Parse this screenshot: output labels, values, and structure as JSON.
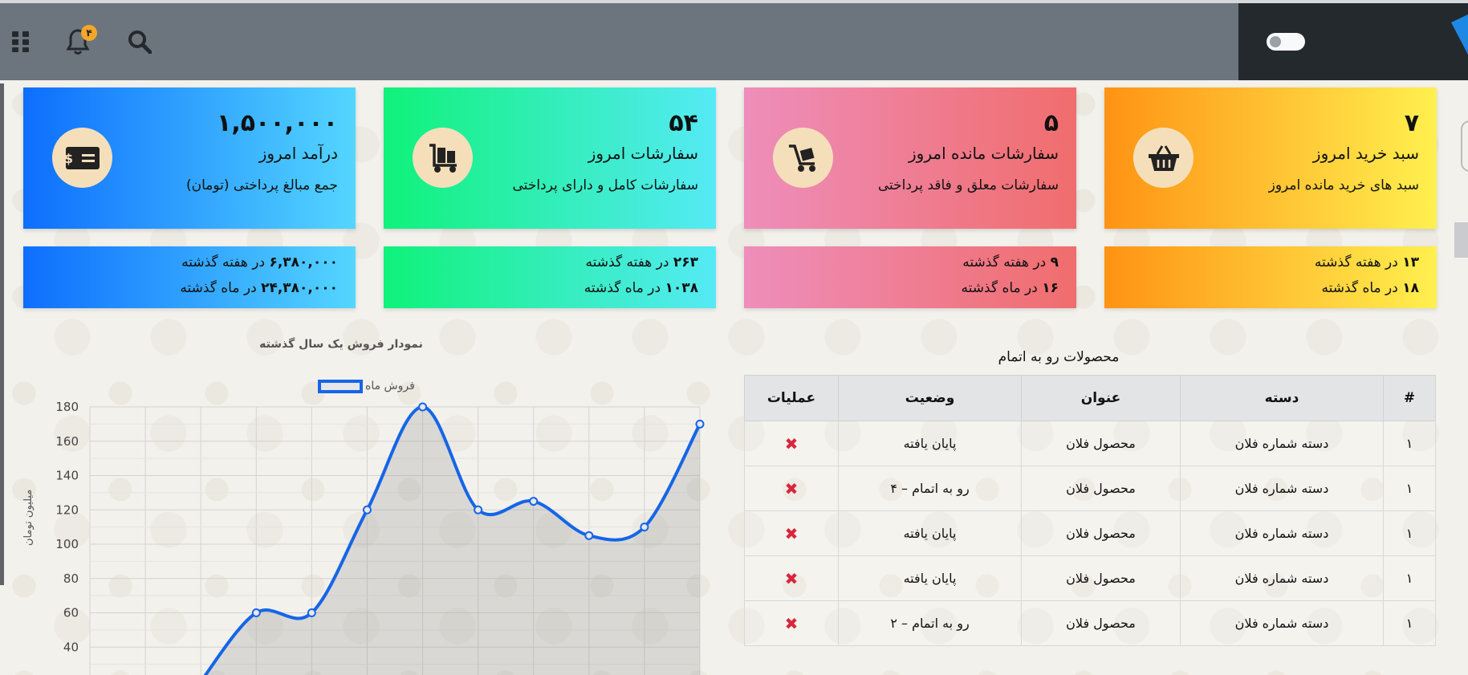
{
  "header": {
    "notification_count": "۴",
    "icons": [
      "apps-grid-icon",
      "bell-icon",
      "search-icon"
    ]
  },
  "cards": [
    {
      "number": "۷",
      "title": "سبد خرید امروز",
      "desc": "سبد های خرید مانده امروز",
      "icon": "basket-icon",
      "color": "#ff9314"
    },
    {
      "number": "۵",
      "title": "سفارشات مانده امروز",
      "desc": "سفارشات معلق و فاقد پرداختی",
      "icon": "cart-icon",
      "color": "#f06d6d"
    },
    {
      "number": "۵۴",
      "title": "سفارشات امروز",
      "desc": "سفارشات کامل و دارای پرداختی",
      "icon": "trolley-icon",
      "color": "#0ff27a"
    },
    {
      "number": "۱,۵۰۰,۰۰۰",
      "title": "درآمد امروز",
      "desc": "جمع مبالغ پرداختی (تومان)",
      "icon": "money-icon",
      "color": "#0d6efd"
    }
  ],
  "subcards": [
    {
      "v1": "۱۳",
      "t1": "در هفته گذشته",
      "v2": "۱۸",
      "t2": "در ماه گذشته"
    },
    {
      "v1": "۹",
      "t1": "در هفته گذشته",
      "v2": "۱۶",
      "t2": "در ماه گذشته"
    },
    {
      "v1": "۲۶۳",
      "t1": "در هفته گذشته",
      "v2": "۱۰۳۸",
      "t2": "در ماه گذشته"
    },
    {
      "v1": "۶,۳۸۰,۰۰۰",
      "t1": "در هفته گذشته",
      "v2": "۲۴,۳۸۰,۰۰۰",
      "t2": "در ماه گذشته"
    }
  ],
  "chart_data": {
    "type": "area",
    "title": "نمودار فروش یک سال گذشته",
    "ylabel": "میلیون تومان",
    "series": [
      {
        "name": "فروش ماه",
        "values": [
          null,
          null,
          20,
          60,
          60,
          120,
          180,
          120,
          125,
          105,
          110,
          170
        ]
      }
    ],
    "ylim": [
      20,
      180
    ],
    "yticks": [
      40,
      60,
      80,
      100,
      120,
      140,
      160,
      180
    ],
    "grid": true,
    "line_color": "#1565e8"
  },
  "table": {
    "title": "محصولات رو به اتمام",
    "headers": [
      "#",
      "دسته",
      "عنوان",
      "وضعیت",
      "عملیات"
    ],
    "rows": [
      {
        "num": "۱",
        "category": "دسته شماره فلان",
        "name": "محصول فلان",
        "status": "پایان یافته",
        "action": "✖"
      },
      {
        "num": "۱",
        "category": "دسته شماره فلان",
        "name": "محصول فلان",
        "status": "رو به اتمام – ۴",
        "action": "✖"
      },
      {
        "num": "۱",
        "category": "دسته شماره فلان",
        "name": "محصول فلان",
        "status": "پایان یافته",
        "action": "✖"
      },
      {
        "num": "۱",
        "category": "دسته شماره فلان",
        "name": "محصول فلان",
        "status": "پایان یافته",
        "action": "✖"
      },
      {
        "num": "۱",
        "category": "دسته شماره فلان",
        "name": "محصول فلان",
        "status": "رو به اتمام – ۲",
        "action": "✖"
      }
    ]
  }
}
